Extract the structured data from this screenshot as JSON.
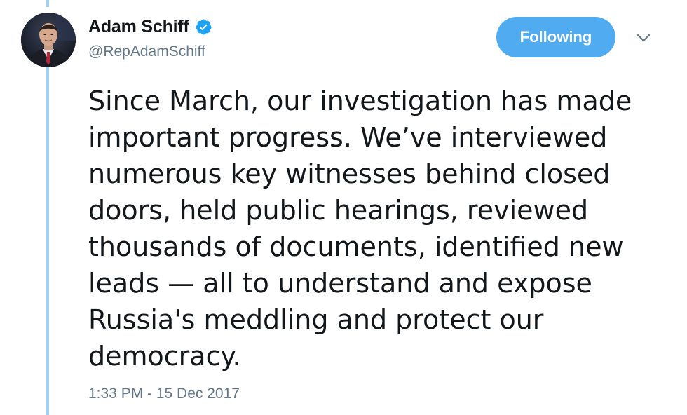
{
  "tweet": {
    "author": {
      "display_name": "Adam Schiff",
      "handle": "@RepAdamSchiff",
      "verified": true
    },
    "follow_button_label": "Following",
    "text_lines": [
      "Since March, our investigation has made",
      "important progress. We’ve interviewed",
      "numerous key witnesses behind closed",
      "doors, held public hearings, reviewed",
      "thousands of documents, identified new",
      "leads — all to understand and expose",
      "Russia's meddling and protect our",
      "democracy."
    ],
    "timestamp": "1:33 PM - 15 Dec 2017"
  },
  "colors": {
    "accent": "#50abf1",
    "thread_line": "#9fd0f5",
    "verified_badge": "#1da1f2",
    "secondary_text": "#657786",
    "primary_text": "#14171a"
  },
  "icons": {
    "verified": "verified-badge-icon",
    "menu": "chevron-down-icon"
  }
}
